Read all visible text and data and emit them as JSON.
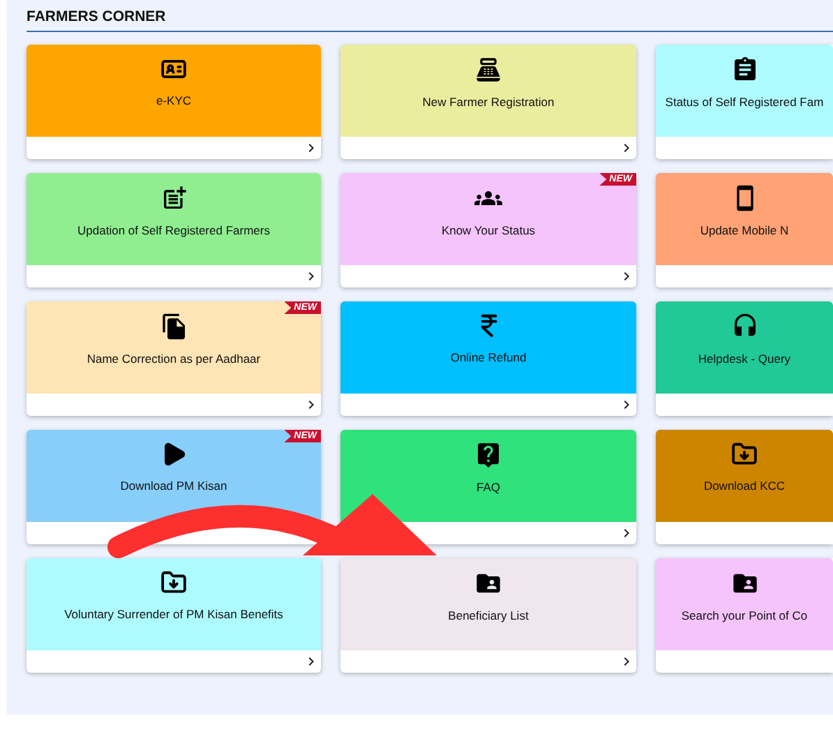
{
  "section": {
    "title": "FARMERS CORNER"
  },
  "cards": [
    {
      "label": "e-KYC",
      "color": "#ffa500"
    },
    {
      "label": "New Farmer Registration",
      "color": "#eaed9e"
    },
    {
      "label": "Status of Self Registered Fam",
      "color": "#aefbff"
    },
    {
      "label": "Updation of Self Registered Farmers",
      "color": "#90ee90"
    },
    {
      "label": "Know Your Status",
      "color": "#f5c4fc",
      "badge": "NEW"
    },
    {
      "label": "Update Mobile N",
      "color": "#ffa275"
    },
    {
      "label": "Name Correction as per Aadhaar",
      "color": "#ffe4b5",
      "badge": "NEW"
    },
    {
      "label": "Online Refund",
      "color": "#00bfff"
    },
    {
      "label": "Helpdesk - Query",
      "color": "#20c997"
    },
    {
      "label": "Download PM Kisan",
      "color": "#87cefa",
      "badge": "NEW"
    },
    {
      "label": "FAQ",
      "color": "#2fe27c"
    },
    {
      "label": "Download KCC",
      "color": "#cd8500"
    },
    {
      "label": "Voluntary Surrender of PM Kisan Benefits",
      "color": "#aefbff"
    },
    {
      "label": "Beneficiary List",
      "color": "#efe6ee"
    },
    {
      "label": "Search your Point of Co",
      "color": "#f5c4fc"
    }
  ]
}
